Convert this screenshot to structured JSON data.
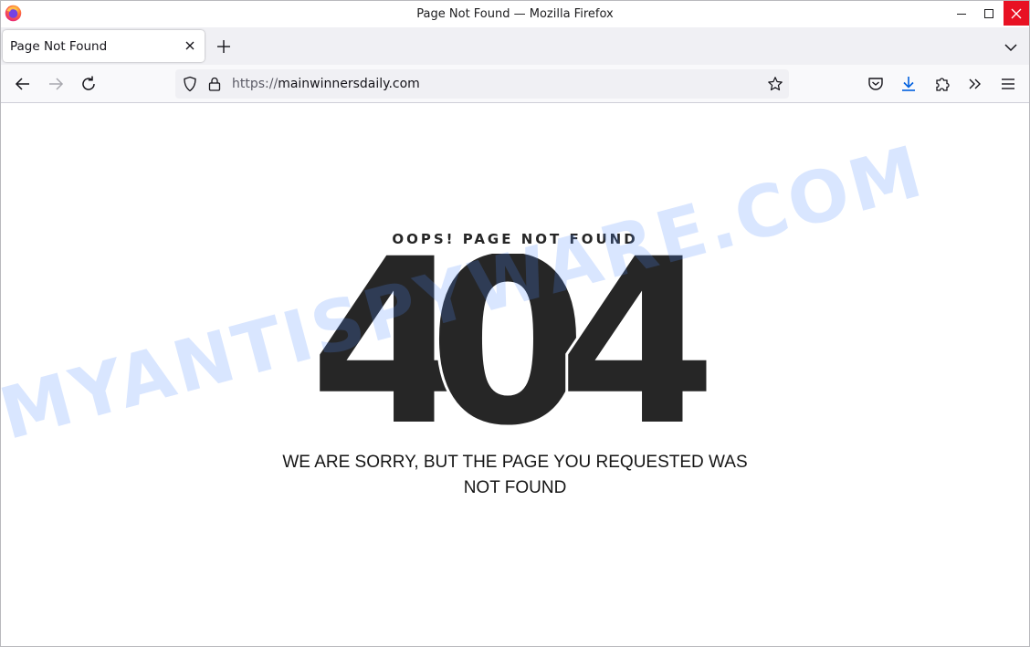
{
  "window": {
    "title": "Page Not Found — Mozilla Firefox"
  },
  "tabs": [
    {
      "label": "Page Not Found",
      "active": true
    }
  ],
  "navbar": {
    "url_scheme": "https://",
    "url_host": "mainwinnersdaily.com"
  },
  "page": {
    "heading": "OOPS! PAGE NOT FOUND",
    "code_digit_1": "4",
    "code_digit_2": "0",
    "code_digit_3": "4",
    "message_line_1": "WE ARE SORRY, BUT THE PAGE YOU REQUESTED WAS",
    "message_line_2": "NOT FOUND"
  },
  "watermark": {
    "text": "MYANTISPYWARE.COM"
  },
  "colors": {
    "close_button": "#e81123",
    "tabstrip": "#f0f0f4",
    "urlbar": "#f0f0f4",
    "code_text": "#262626",
    "download_accent": "#0060df"
  }
}
